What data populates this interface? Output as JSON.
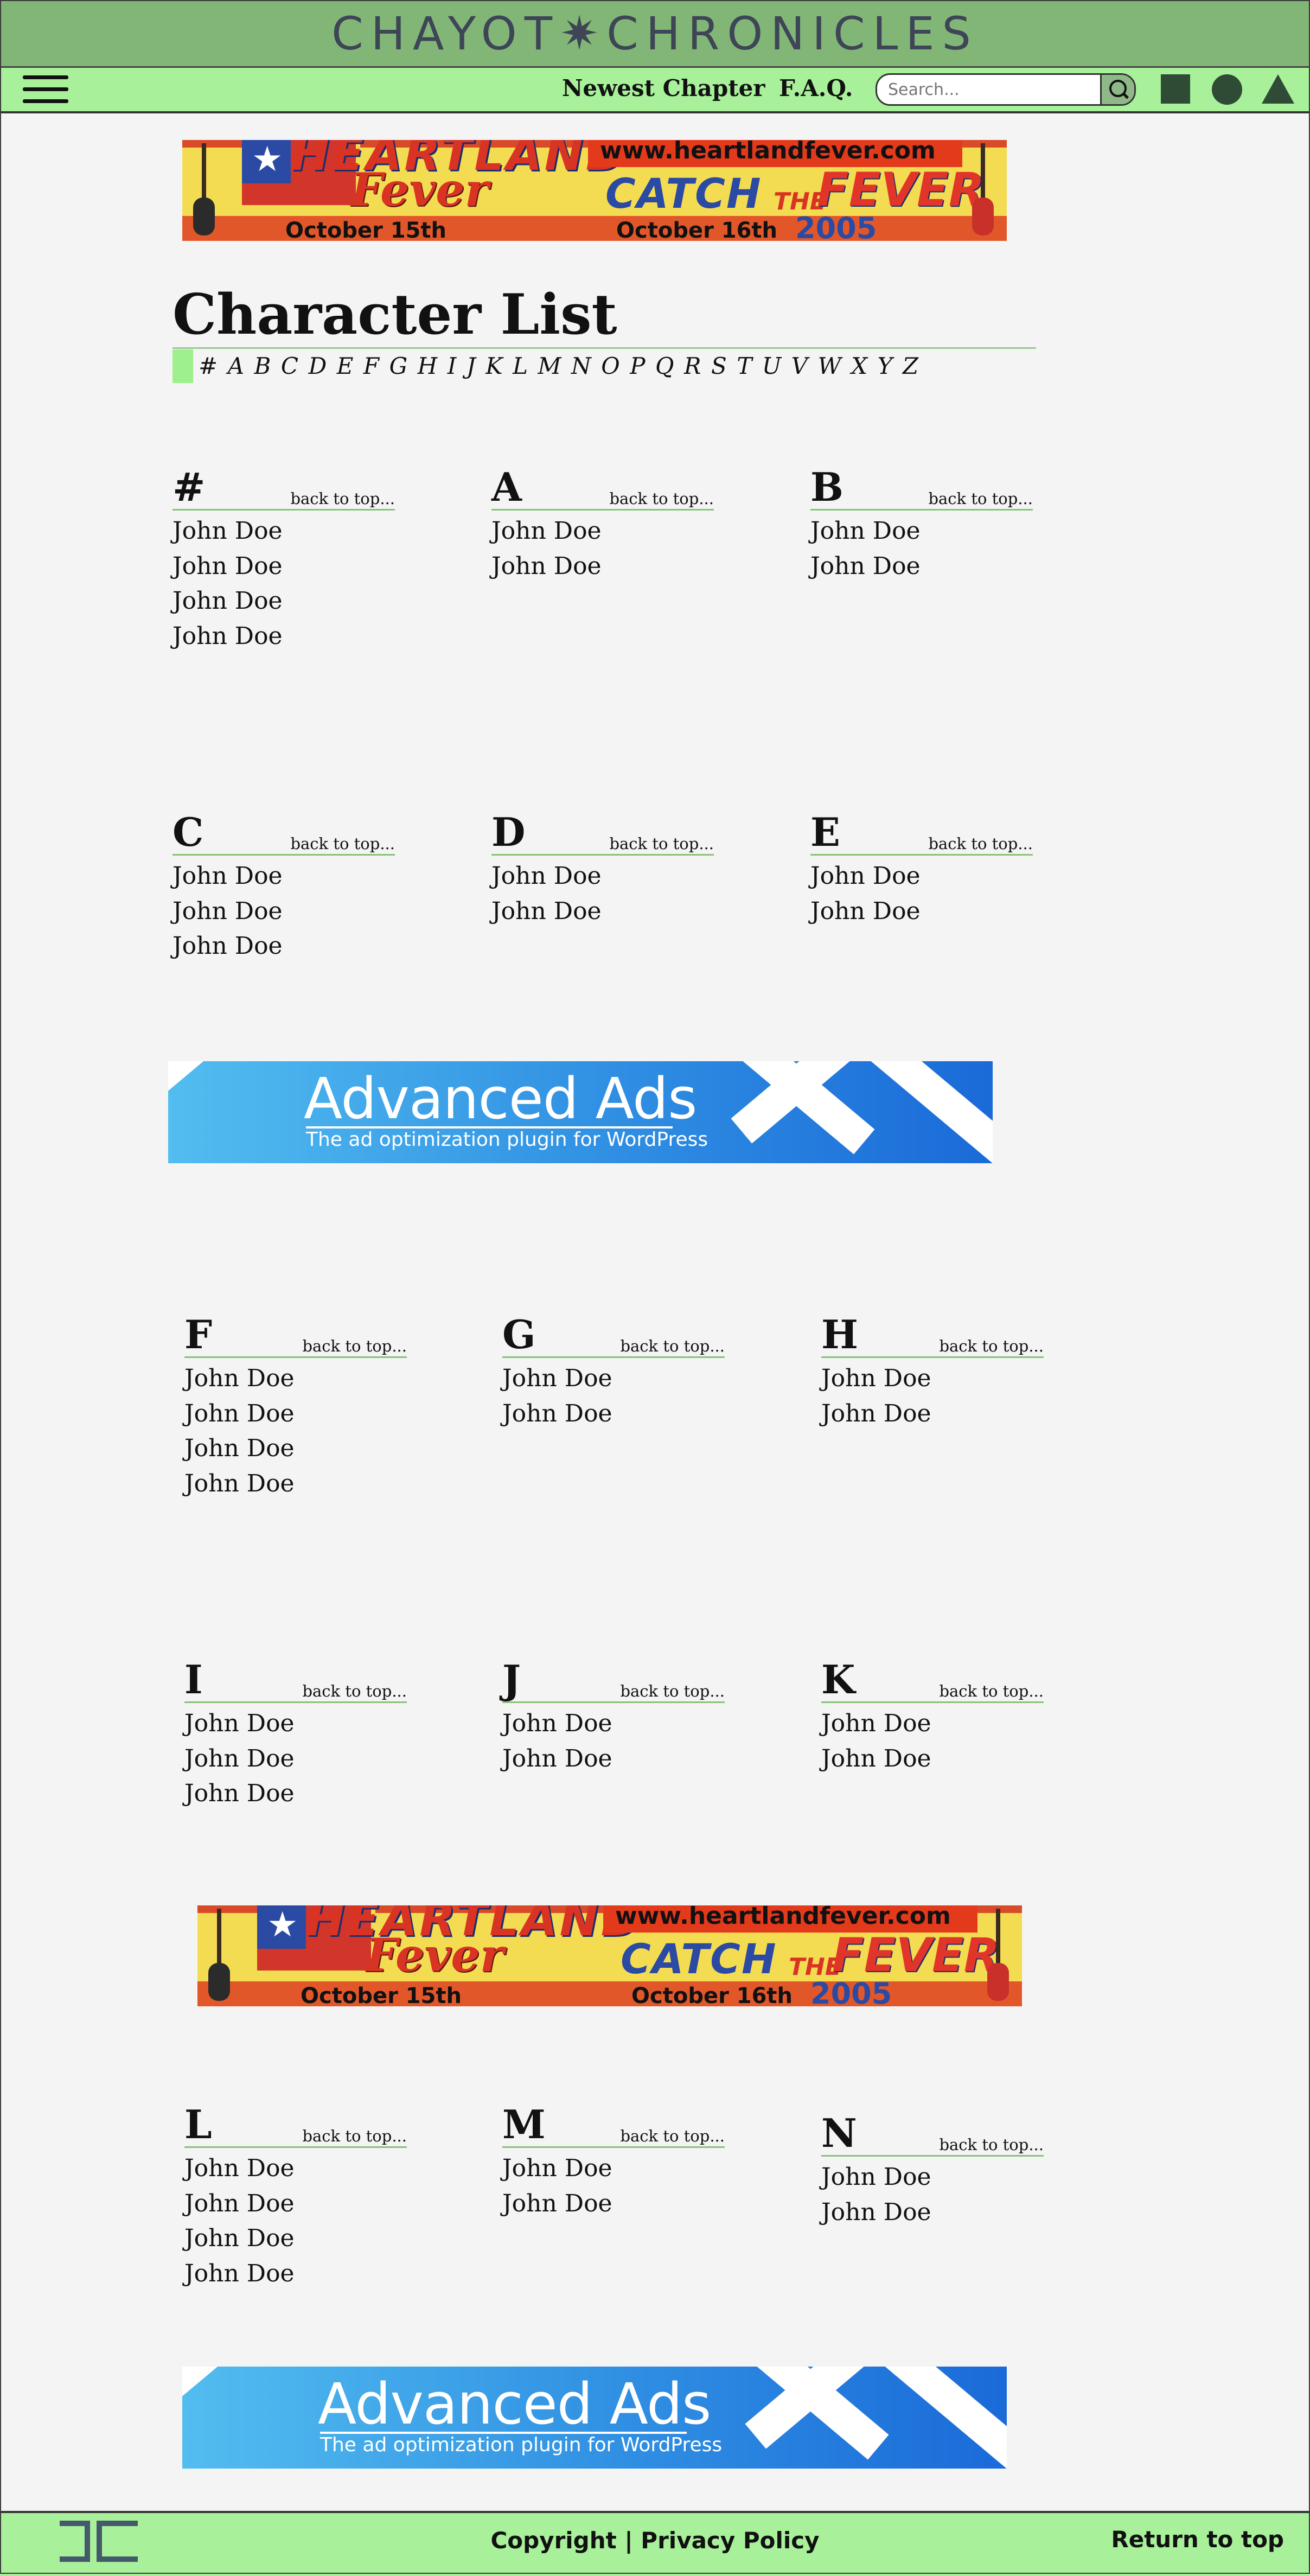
{
  "header": {
    "logo_left": "CHAYOT",
    "logo_star": "✷",
    "logo_right": "CHRONICLES"
  },
  "nav": {
    "menu_icon": "hamburger-menu-icon",
    "newest_chapter": "Newest Chapter",
    "faq": "F.A.Q.",
    "search_placeholder": "Search...",
    "search_icon": "magnifier-icon",
    "shape_icons": [
      "square-icon",
      "circle-icon",
      "triangle-icon"
    ]
  },
  "ads": {
    "heartland": {
      "heartland": "HEARTLAND",
      "fever": "Fever",
      "url": "www.heartlandfever.com",
      "catch": "CATCH",
      "the": "THE",
      "fever2": "FEVER",
      "date1": "October 15th",
      "date2": "October 16th",
      "year": "2005"
    },
    "advanced": {
      "title": "Advanced Ads",
      "subtitle": "The ad optimization plugin for WordPress"
    }
  },
  "page": {
    "title": "Character List",
    "letter_index": [
      "#",
      "A",
      "B",
      "C",
      "D",
      "E",
      "F",
      "G",
      "H",
      "I",
      "J",
      "K",
      "L",
      "M",
      "N",
      "O",
      "P",
      "Q",
      "R",
      "S",
      "T",
      "U",
      "V",
      "W",
      "X",
      "Y",
      "Z"
    ],
    "back_to_top": "back to top..."
  },
  "sections": [
    {
      "letter": "#",
      "names": [
        "John Doe",
        "John Doe",
        "John Doe",
        "John Doe"
      ]
    },
    {
      "letter": "A",
      "names": [
        "John Doe",
        "John Doe"
      ]
    },
    {
      "letter": "B",
      "names": [
        "John Doe",
        "John Doe"
      ]
    },
    {
      "letter": "C",
      "names": [
        "John Doe",
        "John Doe",
        "John Doe"
      ]
    },
    {
      "letter": "D",
      "names": [
        "John Doe",
        "John Doe"
      ]
    },
    {
      "letter": "E",
      "names": [
        "John Doe",
        "John Doe"
      ]
    },
    {
      "letter": "F",
      "names": [
        "John Doe",
        "John Doe",
        "John Doe",
        "John Doe"
      ]
    },
    {
      "letter": "G",
      "names": [
        "John Doe",
        "John Doe"
      ]
    },
    {
      "letter": "H",
      "names": [
        "John Doe",
        "John Doe"
      ]
    },
    {
      "letter": "I",
      "names": [
        "John Doe",
        "John Doe",
        "John Doe"
      ]
    },
    {
      "letter": "J",
      "names": [
        "John Doe",
        "John Doe"
      ]
    },
    {
      "letter": "K",
      "names": [
        "John Doe",
        "John Doe"
      ]
    },
    {
      "letter": "L",
      "names": [
        "John Doe",
        "John Doe",
        "John Doe",
        "John Doe"
      ]
    },
    {
      "letter": "M",
      "names": [
        "John Doe",
        "John Doe"
      ]
    },
    {
      "letter": "N",
      "names": [
        "John Doe",
        "John Doe"
      ]
    }
  ],
  "footer": {
    "copyright": "Copyright | Privacy Policy",
    "return_to_top": "Return to top"
  },
  "colors": {
    "header_bg": "#82b676",
    "nav_bg": "#a8f09a",
    "accent_rule": "#86c27b",
    "page_bg": "#f4f4f4"
  }
}
